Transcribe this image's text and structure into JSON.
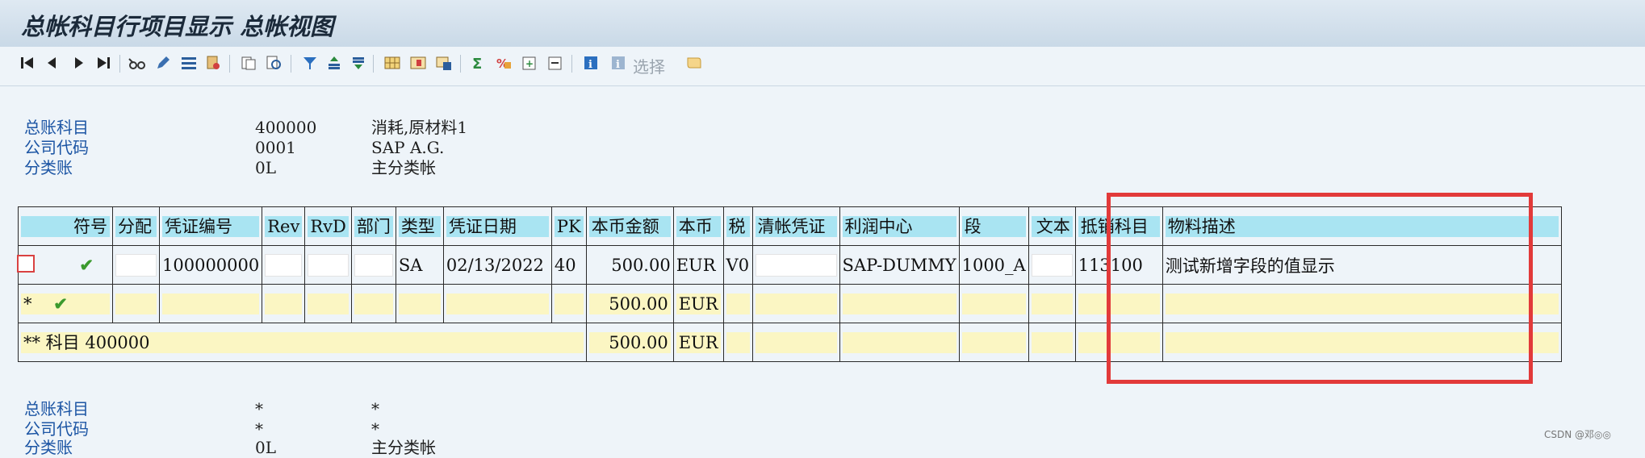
{
  "window": {
    "title": "总帐科目行项目显示 总帐视图"
  },
  "toolbar": {
    "select_label": "选择"
  },
  "header_top": [
    {
      "label": "总账科目",
      "value": "400000",
      "desc": "消耗,原材料1"
    },
    {
      "label": "公司代码",
      "value": "0001",
      "desc": "SAP A.G."
    },
    {
      "label": "分类账",
      "value": "0L",
      "desc": "主分类帐"
    }
  ],
  "table": {
    "columns": [
      "符号",
      "分配",
      "凭证编号",
      "Rev",
      "RvD",
      "部门",
      "类型",
      "凭证日期",
      "PK",
      "本币金额",
      "本币",
      "税",
      "清帐凭证",
      "利润中心",
      "段",
      "文本",
      "抵销科目",
      "物料描述"
    ],
    "row1": {
      "symbol": "✔",
      "doc_no": "100000000",
      "type": "SA",
      "doc_date": "02/13/2022",
      "pk": "40",
      "amount": "500.00",
      "currency": "EUR",
      "tax": "V0",
      "profit_center": "SAP-DUMMY",
      "segment": "1000_A",
      "offset_acct": "113100",
      "material_desc": "测试新增字段的值显示"
    },
    "row2": {
      "marker": "*",
      "symbol": "✔",
      "amount": "500.00",
      "currency": "EUR"
    },
    "row3": {
      "label": "** 科目 400000",
      "amount": "500.00",
      "currency": "EUR"
    }
  },
  "header_bottom": [
    {
      "label": "总账科目",
      "value": "*",
      "desc": "*"
    },
    {
      "label": "公司代码",
      "value": "*",
      "desc": "*"
    },
    {
      "label": "分类账",
      "value": "0L",
      "desc": "主分类帐"
    }
  ],
  "watermark": "CSDN @邓◎◎",
  "colors": {
    "accent_label": "#1c55a4",
    "header_cell": "#a9e4f2",
    "total_cell": "#fbf6c3",
    "highlight_box": "#e23a3a"
  }
}
